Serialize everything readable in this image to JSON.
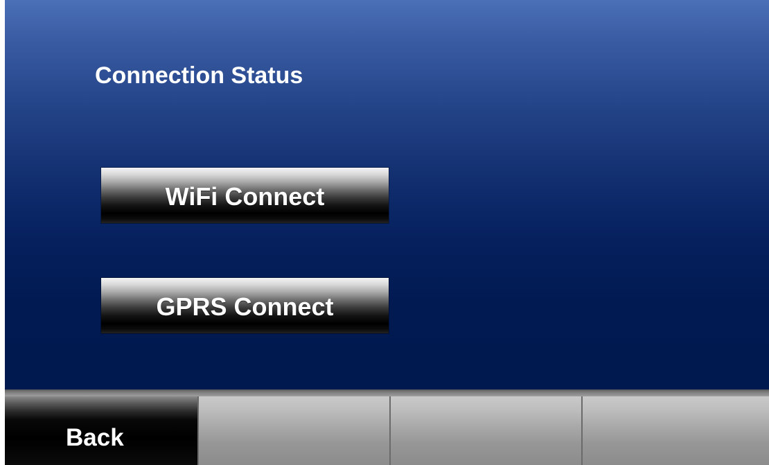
{
  "main": {
    "title": "Connection Status",
    "buttons": {
      "wifi_label": "WiFi Connect",
      "gprs_label": "GPRS Connect"
    }
  },
  "softkeys": {
    "back_label": "Back",
    "slot2_label": "",
    "slot3_label": "",
    "slot4_label": ""
  },
  "colors": {
    "background_top": "#4b70b8",
    "background_bottom": "#001a4f",
    "button_text": "#ffffff"
  }
}
